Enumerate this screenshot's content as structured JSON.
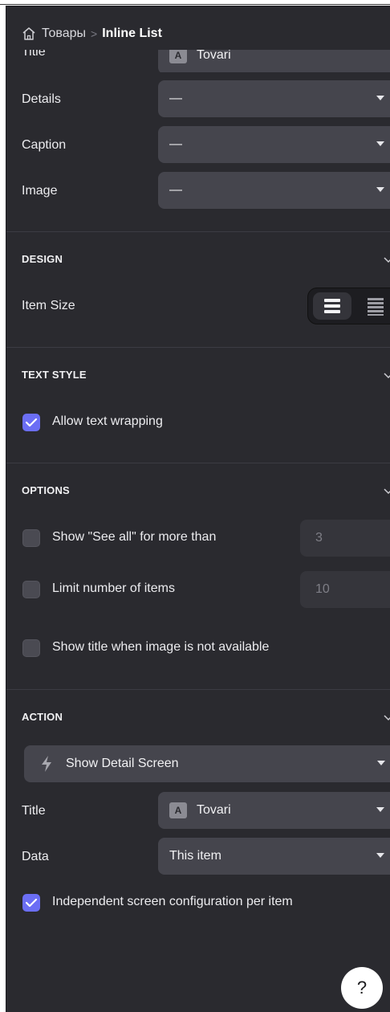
{
  "breadcrumb": {
    "parent": "Товары",
    "separator": ">",
    "current": "Inline List"
  },
  "fields": {
    "title_partial": {
      "label": "Title",
      "value": "Tovari"
    },
    "details": {
      "label": "Details",
      "value": "—"
    },
    "caption": {
      "label": "Caption",
      "value": "—"
    },
    "image": {
      "label": "Image",
      "value": "—"
    }
  },
  "design": {
    "header": "DESIGN",
    "item_size_label": "Item Size"
  },
  "text_style": {
    "header": "TEXT STYLE",
    "allow_wrap": {
      "label": "Allow text wrapping",
      "checked": true
    }
  },
  "options": {
    "header": "OPTIONS",
    "see_all": {
      "label": "Show \"See all\" for more than",
      "checked": false,
      "value": "3"
    },
    "limit": {
      "label": "Limit number of items",
      "checked": false,
      "value": "10"
    },
    "show_title": {
      "label": "Show title when image is not available",
      "checked": false
    }
  },
  "action": {
    "header": "ACTION",
    "button": "Show Detail Screen",
    "title": {
      "label": "Title",
      "badge": "A",
      "value": "Tovari"
    },
    "data": {
      "label": "Data",
      "value": "This item"
    },
    "independent": {
      "label": "Independent screen configuration per item",
      "checked": true
    }
  },
  "help": {
    "label": "?"
  },
  "colors": {
    "panel": "#2a2a2f",
    "field": "#45454d",
    "accent": "#6b6ef5"
  }
}
